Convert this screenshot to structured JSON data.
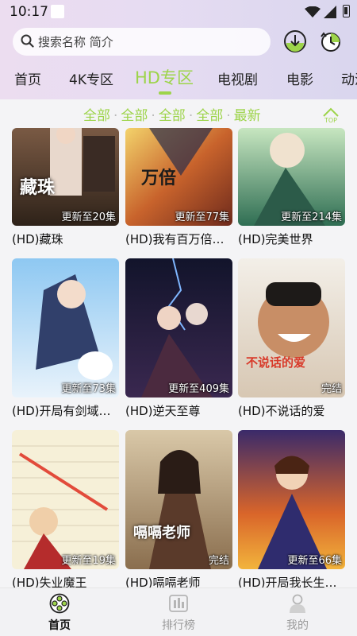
{
  "status_bar": {
    "time": "10:17"
  },
  "search": {
    "placeholder": "搜索名称 简介"
  },
  "tabs": [
    {
      "label": "首页"
    },
    {
      "label": "4K专区"
    },
    {
      "label": "HD专区"
    },
    {
      "label": "电视剧"
    },
    {
      "label": "电影"
    },
    {
      "label": "动漫"
    }
  ],
  "active_tab": "HD专区",
  "filters": [
    "全部",
    "全部",
    "全部",
    "全部",
    "最新"
  ],
  "top_button": {
    "label": "TOP"
  },
  "videos": [
    {
      "title": "(HD)藏珠",
      "badge": "更新至20集",
      "poster_text": "藏珠"
    },
    {
      "title": "(HD)我有百万倍…",
      "badge": "更新至77集",
      "poster_text": ""
    },
    {
      "title": "(HD)完美世界",
      "badge": "更新至214集",
      "poster_text": ""
    },
    {
      "title": "(HD)开局有剑域…",
      "badge": "更新至73集",
      "poster_text": ""
    },
    {
      "title": "(HD)逆天至尊",
      "badge": "更新至409集",
      "poster_text": ""
    },
    {
      "title": "(HD)不说话的爱",
      "badge": "完结",
      "poster_text": "不说话的爱"
    },
    {
      "title": "(HD)失业魔王",
      "badge": "更新至19集",
      "poster_text": ""
    },
    {
      "title": "(HD)嗝嗝老师",
      "badge": "完结",
      "poster_text": "嗝嗝老师"
    },
    {
      "title": "(HD)开局我长生…",
      "badge": "更新至66集",
      "poster_text": ""
    }
  ],
  "bottom_nav": [
    {
      "label": "首页",
      "icon": "film-reel-icon"
    },
    {
      "label": "排行榜",
      "icon": "chart-icon"
    },
    {
      "label": "我的",
      "icon": "profile-icon"
    }
  ],
  "colors": {
    "accent": "#9dd44a",
    "header_start": "#ecddf0",
    "header_end": "#d9d6ee"
  }
}
